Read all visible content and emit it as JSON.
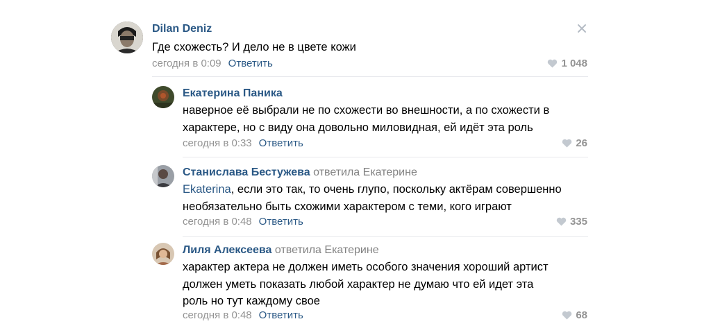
{
  "comments": [
    {
      "author": "Dilan Deniz",
      "reply_to": "",
      "mention": "",
      "text_lines": [
        "Где схожесть? И дело не в цвете кожи"
      ],
      "time": "сегодня в 0:09",
      "reply_label": "Ответить",
      "likes": "1 048"
    },
    {
      "author": "Екатерина Паника",
      "reply_to": "",
      "mention": "",
      "text_lines": [
        "наверное её выбрали не по схожести во внешности, а по схожести в",
        "характере, но с виду она довольно миловидная, ей идёт эта роль"
      ],
      "time": "сегодня в 0:33",
      "reply_label": "Ответить",
      "likes": "26"
    },
    {
      "author": "Станислава Бестужева",
      "reply_to": "ответила Екатерине",
      "mention": "Ekaterina",
      "text_lines": [
        ", если это так, то очень глупо, поскольку актёрам совершенно",
        "необязательно быть схожими характером с теми, кого играют"
      ],
      "time": "сегодня в 0:48",
      "reply_label": "Ответить",
      "likes": "335"
    },
    {
      "author": "Лиля Алексеева",
      "reply_to": "ответила Екатерине",
      "mention": "",
      "text_lines": [
        "характер актера не должен иметь особого значения хороший артист",
        "должен уметь показать любой характер не думаю что ей идет эта",
        "роль но тут каждому свое"
      ],
      "time": "сегодня в 0:48",
      "reply_label": "Ответить",
      "likes": "68"
    }
  ],
  "icons": {
    "close": "close-icon",
    "like": "heart-icon"
  },
  "colors": {
    "link": "#2a5885",
    "meta": "#939393",
    "divider": "#e7e8ec"
  }
}
